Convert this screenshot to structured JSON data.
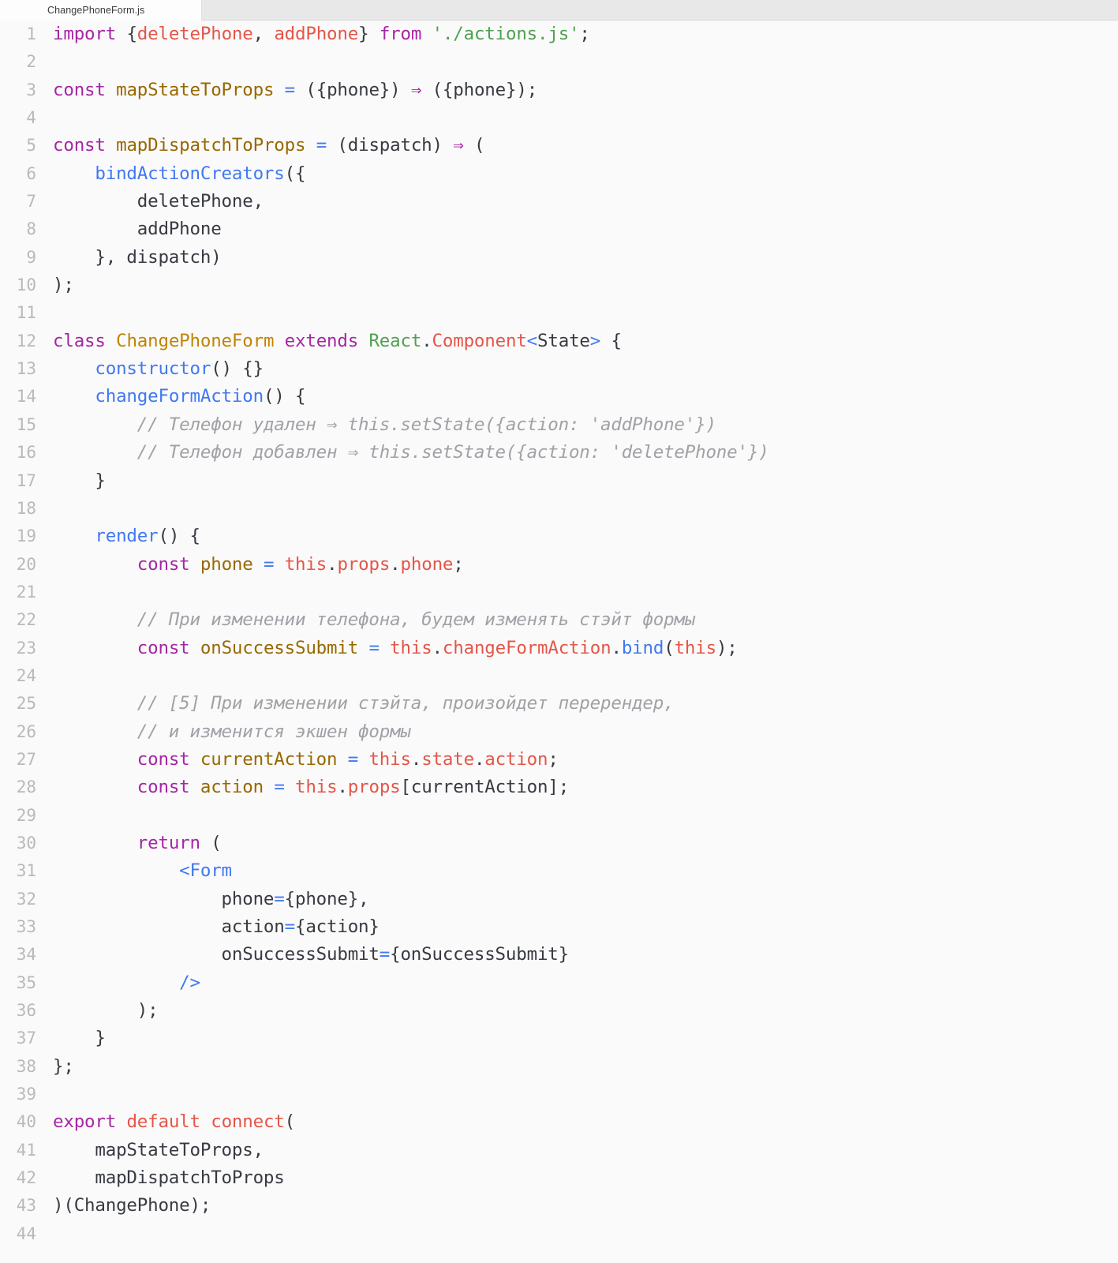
{
  "tab": {
    "filename": "ChangePhoneForm.js"
  },
  "colors": {
    "background": "#fafafa",
    "tab_inactive": "#e8e8e8",
    "gutter_text": "#b9b9b9",
    "keyword": "#a626a4",
    "import_name": "#e45649",
    "string": "#50a14f",
    "function": "#4078f2",
    "variable": "#986801",
    "class_name": "#c18401",
    "comment": "#a0a1a7",
    "punctuation": "#383a42"
  },
  "editor": {
    "first_line": 1,
    "last_line": 44,
    "lines": [
      {
        "n": 1,
        "tokens": [
          {
            "t": "import",
            "c": "kw"
          },
          {
            "t": " ",
            "c": "plain"
          },
          {
            "t": "{",
            "c": "punc"
          },
          {
            "t": "deletePhone",
            "c": "imp"
          },
          {
            "t": ", ",
            "c": "punc"
          },
          {
            "t": "addPhone",
            "c": "imp"
          },
          {
            "t": "}",
            "c": "punc"
          },
          {
            "t": " ",
            "c": "plain"
          },
          {
            "t": "from",
            "c": "kw"
          },
          {
            "t": " ",
            "c": "plain"
          },
          {
            "t": "'./actions.js'",
            "c": "str"
          },
          {
            "t": ";",
            "c": "punc"
          }
        ]
      },
      {
        "n": 2,
        "tokens": []
      },
      {
        "n": 3,
        "tokens": [
          {
            "t": "const",
            "c": "kw"
          },
          {
            "t": " ",
            "c": "plain"
          },
          {
            "t": "mapStateToProps",
            "c": "var"
          },
          {
            "t": " ",
            "c": "plain"
          },
          {
            "t": "=",
            "c": "op"
          },
          {
            "t": " ",
            "c": "plain"
          },
          {
            "t": "({phone})",
            "c": "punc"
          },
          {
            "t": " ",
            "c": "plain"
          },
          {
            "t": "⇒",
            "c": "arrow"
          },
          {
            "t": " ",
            "c": "plain"
          },
          {
            "t": "({phone});",
            "c": "punc"
          }
        ]
      },
      {
        "n": 4,
        "tokens": []
      },
      {
        "n": 5,
        "tokens": [
          {
            "t": "const",
            "c": "kw"
          },
          {
            "t": " ",
            "c": "plain"
          },
          {
            "t": "mapDispatchToProps",
            "c": "var"
          },
          {
            "t": " ",
            "c": "plain"
          },
          {
            "t": "=",
            "c": "op"
          },
          {
            "t": " ",
            "c": "plain"
          },
          {
            "t": "(dispatch)",
            "c": "punc"
          },
          {
            "t": " ",
            "c": "plain"
          },
          {
            "t": "⇒",
            "c": "arrow"
          },
          {
            "t": " ",
            "c": "plain"
          },
          {
            "t": "(",
            "c": "punc"
          }
        ]
      },
      {
        "n": 6,
        "tokens": [
          {
            "t": "    ",
            "c": "plain"
          },
          {
            "t": "bindActionCreators",
            "c": "fn"
          },
          {
            "t": "({",
            "c": "punc"
          }
        ]
      },
      {
        "n": 7,
        "tokens": [
          {
            "t": "        deletePhone,",
            "c": "plain"
          }
        ]
      },
      {
        "n": 8,
        "tokens": [
          {
            "t": "        addPhone",
            "c": "plain"
          }
        ]
      },
      {
        "n": 9,
        "tokens": [
          {
            "t": "    }, dispatch)",
            "c": "punc"
          }
        ]
      },
      {
        "n": 10,
        "tokens": [
          {
            "t": ");",
            "c": "punc"
          }
        ]
      },
      {
        "n": 11,
        "tokens": []
      },
      {
        "n": 12,
        "tokens": [
          {
            "t": "class",
            "c": "kw"
          },
          {
            "t": " ",
            "c": "plain"
          },
          {
            "t": "ChangePhoneForm",
            "c": "cls"
          },
          {
            "t": " ",
            "c": "plain"
          },
          {
            "t": "extends",
            "c": "kw"
          },
          {
            "t": " ",
            "c": "plain"
          },
          {
            "t": "React",
            "c": "ns"
          },
          {
            "t": ".",
            "c": "punc"
          },
          {
            "t": "Component",
            "c": "this"
          },
          {
            "t": "<",
            "c": "type"
          },
          {
            "t": "State",
            "c": "punc"
          },
          {
            "t": ">",
            "c": "type"
          },
          {
            "t": " {",
            "c": "punc"
          }
        ]
      },
      {
        "n": 13,
        "tokens": [
          {
            "t": "    ",
            "c": "plain"
          },
          {
            "t": "constructor",
            "c": "fn"
          },
          {
            "t": "() {}",
            "c": "punc"
          }
        ]
      },
      {
        "n": 14,
        "tokens": [
          {
            "t": "    ",
            "c": "plain"
          },
          {
            "t": "changeFormAction",
            "c": "fn"
          },
          {
            "t": "() {",
            "c": "punc"
          }
        ]
      },
      {
        "n": 15,
        "tokens": [
          {
            "t": "        // Телефон удален ⇒ this.setState({action: 'addPhone'})",
            "c": "cmt"
          }
        ]
      },
      {
        "n": 16,
        "tokens": [
          {
            "t": "        // Телефон добавлен ⇒ this.setState({action: 'deletePhone'})",
            "c": "cmt"
          }
        ]
      },
      {
        "n": 17,
        "tokens": [
          {
            "t": "    }",
            "c": "punc"
          }
        ]
      },
      {
        "n": 18,
        "tokens": []
      },
      {
        "n": 19,
        "tokens": [
          {
            "t": "    ",
            "c": "plain"
          },
          {
            "t": "render",
            "c": "fn"
          },
          {
            "t": "() {",
            "c": "punc"
          }
        ]
      },
      {
        "n": 20,
        "tokens": [
          {
            "t": "        ",
            "c": "plain"
          },
          {
            "t": "const",
            "c": "kw"
          },
          {
            "t": " ",
            "c": "plain"
          },
          {
            "t": "phone",
            "c": "var"
          },
          {
            "t": " ",
            "c": "plain"
          },
          {
            "t": "=",
            "c": "op"
          },
          {
            "t": " ",
            "c": "plain"
          },
          {
            "t": "this",
            "c": "this"
          },
          {
            "t": ".",
            "c": "punc"
          },
          {
            "t": "props",
            "c": "this"
          },
          {
            "t": ".",
            "c": "punc"
          },
          {
            "t": "phone",
            "c": "this"
          },
          {
            "t": ";",
            "c": "punc"
          }
        ]
      },
      {
        "n": 21,
        "tokens": []
      },
      {
        "n": 22,
        "tokens": [
          {
            "t": "        // При изменении телефона, будем изменять стэйт формы",
            "c": "cmt"
          }
        ]
      },
      {
        "n": 23,
        "tokens": [
          {
            "t": "        ",
            "c": "plain"
          },
          {
            "t": "const",
            "c": "kw"
          },
          {
            "t": " ",
            "c": "plain"
          },
          {
            "t": "onSuccessSubmit",
            "c": "var"
          },
          {
            "t": " ",
            "c": "plain"
          },
          {
            "t": "=",
            "c": "op"
          },
          {
            "t": " ",
            "c": "plain"
          },
          {
            "t": "this",
            "c": "this"
          },
          {
            "t": ".",
            "c": "punc"
          },
          {
            "t": "changeFormAction",
            "c": "this"
          },
          {
            "t": ".",
            "c": "punc"
          },
          {
            "t": "bind",
            "c": "fn"
          },
          {
            "t": "(",
            "c": "punc"
          },
          {
            "t": "this",
            "c": "this"
          },
          {
            "t": ");",
            "c": "punc"
          }
        ]
      },
      {
        "n": 24,
        "tokens": []
      },
      {
        "n": 25,
        "tokens": [
          {
            "t": "        // [5] При изменении стэйта, произойдет перерендер,",
            "c": "cmt"
          }
        ]
      },
      {
        "n": 26,
        "tokens": [
          {
            "t": "        // и изменится экшен формы",
            "c": "cmt"
          }
        ]
      },
      {
        "n": 27,
        "tokens": [
          {
            "t": "        ",
            "c": "plain"
          },
          {
            "t": "const",
            "c": "kw"
          },
          {
            "t": " ",
            "c": "plain"
          },
          {
            "t": "currentAction",
            "c": "var"
          },
          {
            "t": " ",
            "c": "plain"
          },
          {
            "t": "=",
            "c": "op"
          },
          {
            "t": " ",
            "c": "plain"
          },
          {
            "t": "this",
            "c": "this"
          },
          {
            "t": ".",
            "c": "punc"
          },
          {
            "t": "state",
            "c": "this"
          },
          {
            "t": ".",
            "c": "punc"
          },
          {
            "t": "action",
            "c": "this"
          },
          {
            "t": ";",
            "c": "punc"
          }
        ]
      },
      {
        "n": 28,
        "tokens": [
          {
            "t": "        ",
            "c": "plain"
          },
          {
            "t": "const",
            "c": "kw"
          },
          {
            "t": " ",
            "c": "plain"
          },
          {
            "t": "action",
            "c": "var"
          },
          {
            "t": " ",
            "c": "plain"
          },
          {
            "t": "=",
            "c": "op"
          },
          {
            "t": " ",
            "c": "plain"
          },
          {
            "t": "this",
            "c": "this"
          },
          {
            "t": ".",
            "c": "punc"
          },
          {
            "t": "props",
            "c": "this"
          },
          {
            "t": "[currentAction];",
            "c": "punc"
          }
        ]
      },
      {
        "n": 29,
        "tokens": []
      },
      {
        "n": 30,
        "tokens": [
          {
            "t": "        ",
            "c": "plain"
          },
          {
            "t": "return",
            "c": "kw"
          },
          {
            "t": " (",
            "c": "punc"
          }
        ]
      },
      {
        "n": 31,
        "tokens": [
          {
            "t": "            ",
            "c": "plain"
          },
          {
            "t": "<Form",
            "c": "fn"
          }
        ]
      },
      {
        "n": 32,
        "tokens": [
          {
            "t": "                phone",
            "c": "plain"
          },
          {
            "t": "=",
            "c": "op"
          },
          {
            "t": "{phone},",
            "c": "punc"
          }
        ]
      },
      {
        "n": 33,
        "tokens": [
          {
            "t": "                action",
            "c": "plain"
          },
          {
            "t": "=",
            "c": "op"
          },
          {
            "t": "{action}",
            "c": "punc"
          }
        ]
      },
      {
        "n": 34,
        "tokens": [
          {
            "t": "                onSuccessSubmit",
            "c": "plain"
          },
          {
            "t": "=",
            "c": "op"
          },
          {
            "t": "{onSuccessSubmit}",
            "c": "punc"
          }
        ]
      },
      {
        "n": 35,
        "tokens": [
          {
            "t": "            ",
            "c": "plain"
          },
          {
            "t": "/>",
            "c": "fn"
          }
        ]
      },
      {
        "n": 36,
        "tokens": [
          {
            "t": "        );",
            "c": "punc"
          }
        ]
      },
      {
        "n": 37,
        "tokens": [
          {
            "t": "    }",
            "c": "punc"
          }
        ]
      },
      {
        "n": 38,
        "tokens": [
          {
            "t": "};",
            "c": "punc"
          }
        ]
      },
      {
        "n": 39,
        "tokens": []
      },
      {
        "n": 40,
        "tokens": [
          {
            "t": "export",
            "c": "kw"
          },
          {
            "t": " ",
            "c": "plain"
          },
          {
            "t": "default",
            "c": "imp"
          },
          {
            "t": " ",
            "c": "plain"
          },
          {
            "t": "connect",
            "c": "imp"
          },
          {
            "t": "(",
            "c": "punc"
          }
        ]
      },
      {
        "n": 41,
        "tokens": [
          {
            "t": "    mapStateToProps,",
            "c": "plain"
          }
        ]
      },
      {
        "n": 42,
        "tokens": [
          {
            "t": "    mapDispatchToProps",
            "c": "plain"
          }
        ]
      },
      {
        "n": 43,
        "tokens": [
          {
            "t": ")(ChangePhone);",
            "c": "punc"
          }
        ]
      },
      {
        "n": 44,
        "tokens": []
      }
    ]
  }
}
